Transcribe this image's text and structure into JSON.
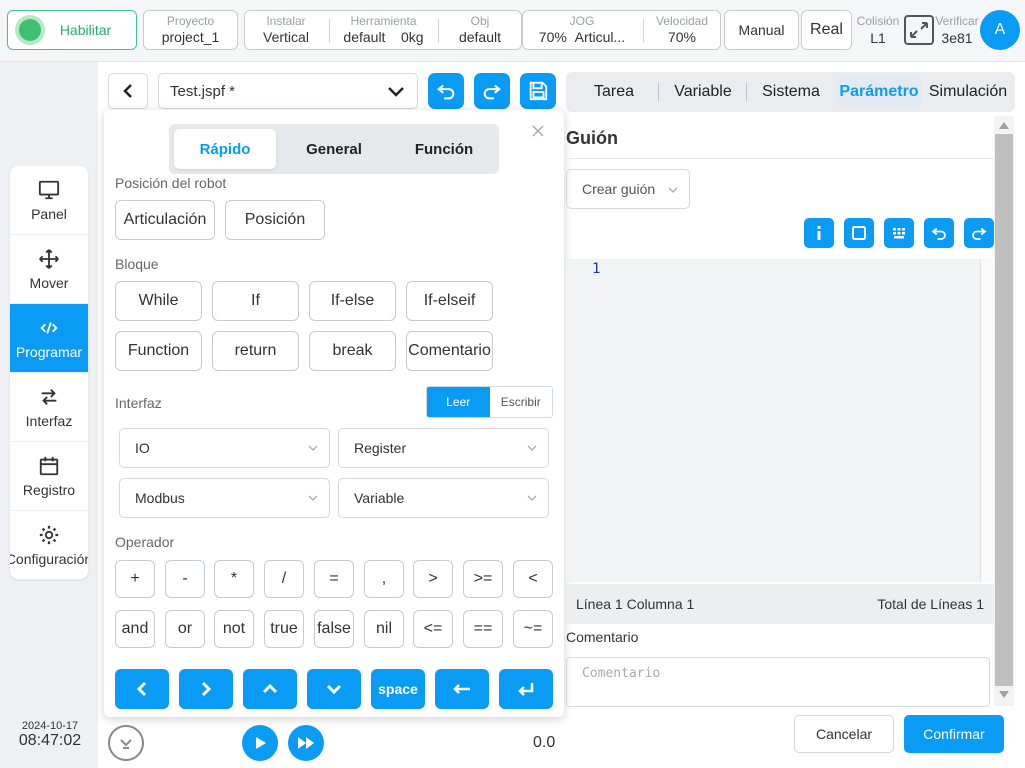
{
  "topbar": {
    "enable_label": "Habilitar",
    "project": {
      "label": "Proyecto",
      "value": "project_1"
    },
    "install": {
      "label": "Instalar",
      "value": "Vertical"
    },
    "tool": {
      "label": "Herramienta",
      "value": "default",
      "weight": "0kg"
    },
    "obj": {
      "label": "Obj",
      "value": "default"
    },
    "jog": {
      "label": "JOG",
      "percent": "70%",
      "mode": "Articul..."
    },
    "speed": {
      "label": "Velocidad",
      "value": "70%"
    },
    "manual_label": "Manual",
    "real_label": "Real",
    "collision": {
      "label": "Colisión",
      "value": "L1"
    },
    "verify": {
      "label": "Verificar",
      "value": "3e81"
    },
    "avatar_letter": "A"
  },
  "nav": {
    "items": [
      {
        "label": "Panel"
      },
      {
        "label": "Mover"
      },
      {
        "label": "Programar"
      },
      {
        "label": "Interfaz"
      },
      {
        "label": "Registro"
      },
      {
        "label": "Configuración"
      }
    ],
    "date": "2024-10-17",
    "time": "08:47:02"
  },
  "file": {
    "name": "Test.jspf *"
  },
  "panel": {
    "tabs": [
      "Rápido",
      "General",
      "Función"
    ],
    "robot_position_label": "Posición del robot",
    "robot_position_buttons": [
      "Articulación",
      "Posición"
    ],
    "block_label": "Bloque",
    "block_buttons": [
      "While",
      "If",
      "If-else",
      "If-elseif",
      "Function",
      "return",
      "break",
      "Comentario"
    ],
    "interface_label": "Interfaz",
    "read_label": "Leer",
    "write_label": "Escribir",
    "selects": [
      "IO",
      "Register",
      "Modbus",
      "Variable"
    ],
    "operator_label": "Operador",
    "operators": [
      "+",
      "-",
      "*",
      "/",
      "=",
      ",",
      ">",
      ">=",
      "<",
      "and",
      "or",
      "not",
      "true",
      "false",
      "nil",
      "<=",
      "==",
      "~="
    ],
    "space_label": "space"
  },
  "right": {
    "tabs": [
      "Tarea",
      "Variable",
      "Sistema",
      "Parámetro",
      "Simulación"
    ],
    "title": "Guión",
    "create_script": "Crear guión",
    "line_number": "1",
    "status_left": "Línea 1 Columna 1",
    "status_right": "Total de Líneas 1",
    "comment_label": "Comentario",
    "comment_placeholder": "Comentario",
    "cancel_label": "Cancelar",
    "confirm_label": "Confirmar"
  },
  "playback": {
    "value": "0.0"
  },
  "colors": {
    "accent": "#0a9bf5",
    "enable": "#27b06e"
  }
}
